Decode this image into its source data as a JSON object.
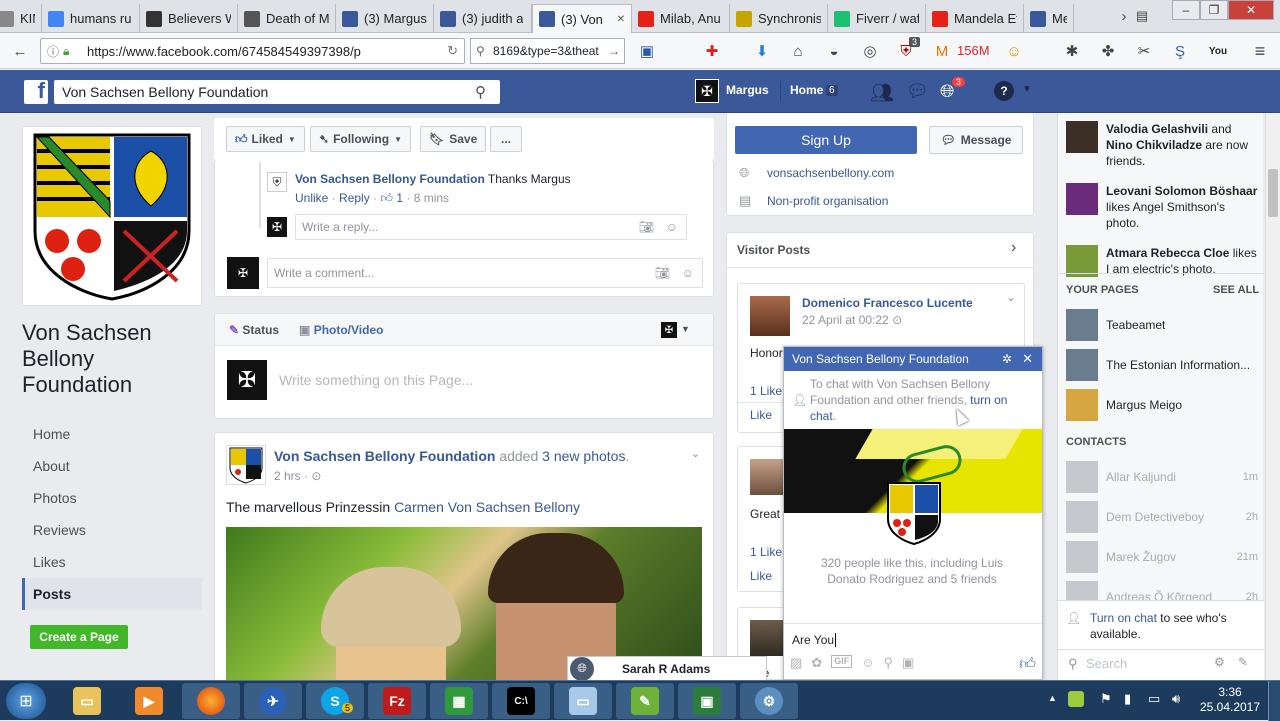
{
  "browser": {
    "tabs": [
      {
        "label": "KING!",
        "icon": "page-icon",
        "color": "#888"
      },
      {
        "label": "humans ru",
        "icon": "google-icon",
        "color": "#4285f4"
      },
      {
        "label": "Believers W",
        "icon": "cross-icon",
        "color": "#333"
      },
      {
        "label": "Death of M",
        "icon": "wiki-icon",
        "color": "#555"
      },
      {
        "label": "(3) Margus",
        "icon": "facebook-icon",
        "color": "#3b5998"
      },
      {
        "label": "(3) judith a",
        "icon": "facebook-icon",
        "color": "#3b5998"
      },
      {
        "label": "(3) Von",
        "icon": "facebook-icon",
        "color": "#3b5998"
      },
      {
        "label": "Milab, Anu",
        "icon": "youtube-icon",
        "color": "#e62117"
      },
      {
        "label": "Synchronis",
        "icon": "site-icon",
        "color": "#c6a500"
      },
      {
        "label": "Fiverr / waf",
        "icon": "fiverr-icon",
        "color": "#1dbf73"
      },
      {
        "label": "Mandela Ef",
        "icon": "youtube-icon",
        "color": "#e62117"
      },
      {
        "label": "Me",
        "icon": "facebook-icon",
        "color": "#3b5998"
      }
    ],
    "url": "https://www.facebook.com/674584549397398/p",
    "search_text": "8169&type=3&theat",
    "badge_count": "3",
    "counter_label": "156M"
  },
  "fb": {
    "search_value": "Von Sachsen Bellony Foundation",
    "user_name": "Margus",
    "home_label": "Home",
    "home_count": "6",
    "notif_count": "3"
  },
  "page": {
    "name": "Von Sachsen Bellony Foundation",
    "nav": [
      "Home",
      "About",
      "Photos",
      "Reviews",
      "Likes",
      "Posts"
    ],
    "create_page": "Create a Page"
  },
  "actions": {
    "liked": "Liked",
    "following": "Following",
    "save": "Save",
    "more": "...",
    "signup": "Sign Up",
    "message": "Message"
  },
  "reply": {
    "author": "Von Sachsen Bellony Foundation",
    "text": "Thanks Margus",
    "unlike": "Unlike",
    "reply": "Reply",
    "likes": "1",
    "time": "8 mins",
    "reply_placeholder": "Write a reply...",
    "comment_placeholder": "Write a comment..."
  },
  "composer": {
    "status": "Status",
    "photo_video": "Photo/Video",
    "placeholder": "Write something on this Page..."
  },
  "post": {
    "author": "Von Sachsen Bellony Foundation",
    "action": "added",
    "action_link": "3 new photos",
    "time": "2 hrs",
    "text": "The marvellous Prinzessin",
    "text_link": "Carmen Von Sachsen Bellony"
  },
  "about": {
    "website": "vonsachsenbellony.com",
    "category": "Non-profit organisation"
  },
  "visitor": {
    "title": "Visitor Posts",
    "p1_author": "Domenico Francesco Lucente",
    "p1_time": "22 April at 00:22",
    "p1_text": "Honor",
    "like_count": "1 Like",
    "like": "Like",
    "p2_text": "Great",
    "p3_text": "spe"
  },
  "chat": {
    "title": "Von Sachsen Bellony Foundation",
    "notice": "To chat with Von Sachsen Bellony Foundation and other friends,",
    "notice_link": "turn on chat",
    "likes_text": "320 people like this, including Luis Donato Rodriguez and 5 friends",
    "input_value": "Are You ",
    "minimized": "Sarah R Adams"
  },
  "sidebar": {
    "ticker": [
      {
        "name": "Valodia Gelashvili",
        "rest1": "and",
        "name2": "Nino Chikviladze",
        "rest2": "are now friends."
      },
      {
        "name": "Leovani Solomon Böshaar",
        "rest1": "likes Angel Smithson's photo."
      },
      {
        "name": "Atmara Rebecca Cloe",
        "rest1": "likes I am electric's photo."
      }
    ],
    "your_pages": "YOUR PAGES",
    "see_all": "SEE ALL",
    "pages": [
      "Teabeamet",
      "The Estonian Information...",
      "Margus Meigo"
    ],
    "contacts_label": "CONTACTS",
    "contacts": [
      {
        "name": "Allar Kaljundi",
        "time": "1m"
      },
      {
        "name": "Dem Detectiveboy",
        "time": "2h"
      },
      {
        "name": "Marek Žugov",
        "time": "21m"
      },
      {
        "name": "Andreas Õ Kõrgend",
        "time": "2h"
      }
    ],
    "turn_on_chat": "Turn on chat",
    "turn_on_rest": "to see who's available.",
    "search_placeholder": "Search"
  },
  "taskbar": {
    "time": "3:36",
    "date": "25.04.2017",
    "skype_badge": "5"
  }
}
